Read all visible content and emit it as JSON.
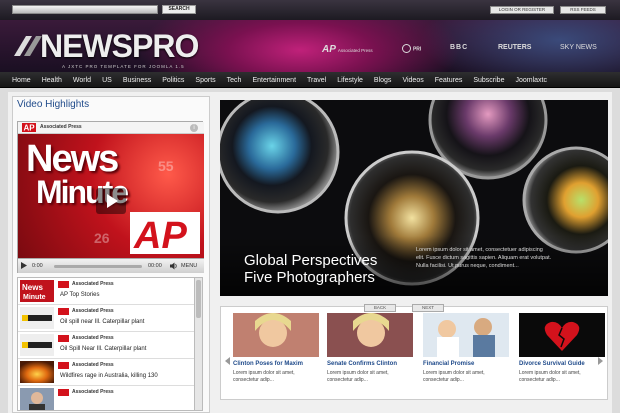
{
  "topbar": {
    "search_placeholder": "",
    "search_button": "SEARCH",
    "login_button": "LOGIN OR REGISTER",
    "rss_button": "RSS FEEDS"
  },
  "header": {
    "logo": "NEWSPRO",
    "tagline": "A JXTC PRO TEMPLATE FOR JOOMLA 1.5",
    "partners": [
      "Associated Press",
      "PRI",
      "BBC",
      "REUTERS",
      "SKY NEWS"
    ]
  },
  "nav": {
    "items": [
      "Home",
      "Health",
      "World",
      "US",
      "Business",
      "Politics",
      "Sports",
      "Tech",
      "Entertainment",
      "Travel",
      "Lifestyle",
      "Blogs",
      "Videos",
      "Features",
      "Subscribe",
      "Joomlaxtc"
    ]
  },
  "video": {
    "section_title": "Video Highlights",
    "player_source": "Associated Press",
    "player_logo_line1": "News",
    "player_logo_line2": "Minute",
    "time_left": "0:00",
    "time_right": "00:00",
    "menu_label": "MENU",
    "clock_numbers": [
      "26",
      "55"
    ],
    "playlist": [
      {
        "source": "Associated Press",
        "title": "AP Top Stories",
        "thumb": "news-minute"
      },
      {
        "source": "Associated Press",
        "title": "Oil spill near Ill. Caterpillar plant",
        "thumb": "caterpillar"
      },
      {
        "source": "Associated Press",
        "title": "Oil Spill Near Ill. Caterpillar plant",
        "thumb": "caterpillar"
      },
      {
        "source": "Associated Press",
        "title": "Wildfires rage in Australia, killing 130",
        "thumb": "fire"
      },
      {
        "source": "Associated Press",
        "title": "",
        "thumb": "person"
      }
    ]
  },
  "feature": {
    "title_line1": "Global Perspectives",
    "title_line2": "Five Photographers",
    "description": "Lorem ipsum dolor sit amet, consectetuer adipiscing elit. Fusce dictum sagittis sapien. Aliquam erat volutpat. Nulla facilisi. Ut purus neque, condiment..."
  },
  "thumbs": {
    "items": [
      {
        "title": "Clinton Poses for Maxim",
        "desc": "Lorem ipsum dolor sit amet, consectetur adip..."
      },
      {
        "title": "Senate Confirms Clinton",
        "desc": "Lorem ipsum dolor sit amet, consectetur adip..."
      },
      {
        "title": "Financial Promise",
        "desc": "Lorem ipsum dolor sit amet, consectetur adip..."
      },
      {
        "title": "Divorce Survival Guide",
        "desc": "Lorem ipsum dolor sit amet, consectetur adip..."
      }
    ],
    "back_label": "BACK",
    "next_label": "NEXT"
  },
  "colors": {
    "accent": "#c0217a",
    "link": "#1f4a8a",
    "ap_red": "#d3121c"
  }
}
